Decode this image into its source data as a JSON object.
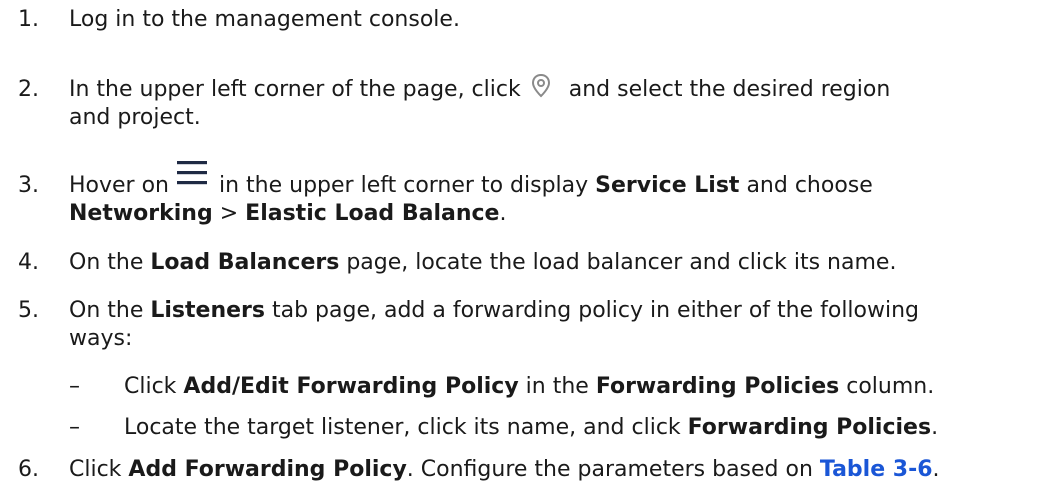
{
  "steps": [
    {
      "number": "1.",
      "text": "Log in to the management console."
    },
    {
      "number": "2.",
      "line1_before": "In the upper left corner of the page, click",
      "icon": "location-pin-icon",
      "line1_after": "and select the desired region",
      "line2": "and project."
    },
    {
      "number": "3.",
      "line1_before": "Hover on",
      "icon": "menu-hamburger-icon",
      "line1_mid": "in the upper left corner to display",
      "service_list": "Service List",
      "line1_after": "and choose",
      "networking": "Networking",
      "separator": ">",
      "elb": "Elastic Load Balance",
      "period": "."
    },
    {
      "number": "4.",
      "before": "On the",
      "page": "Load Balancers",
      "after": "page, locate the load balancer and click its name."
    },
    {
      "number": "5.",
      "before": "On the",
      "tab": "Listeners",
      "after": "tab page, add a forwarding policy in either of the following",
      "line2": "ways:",
      "substeps": [
        {
          "dash": "–",
          "before": "Click",
          "bold1": "Add/Edit Forwarding Policy",
          "mid": "in the",
          "bold2": "Forwarding Policies",
          "after": "column."
        },
        {
          "dash": "–",
          "before": "Locate the target listener, click its name, and click",
          "bold1": "Forwarding Policies",
          "after": "."
        }
      ]
    },
    {
      "number": "6.",
      "before": "Click",
      "bold": "Add Forwarding Policy",
      "mid": ". Configure the parameters based on",
      "link": "Table 3-6",
      "after": "."
    }
  ],
  "colors": {
    "text": "#1a1a1a",
    "link": "#1a56d6",
    "icon_gray": "#8a8a8a",
    "icon_navy": "#1f2a44"
  }
}
